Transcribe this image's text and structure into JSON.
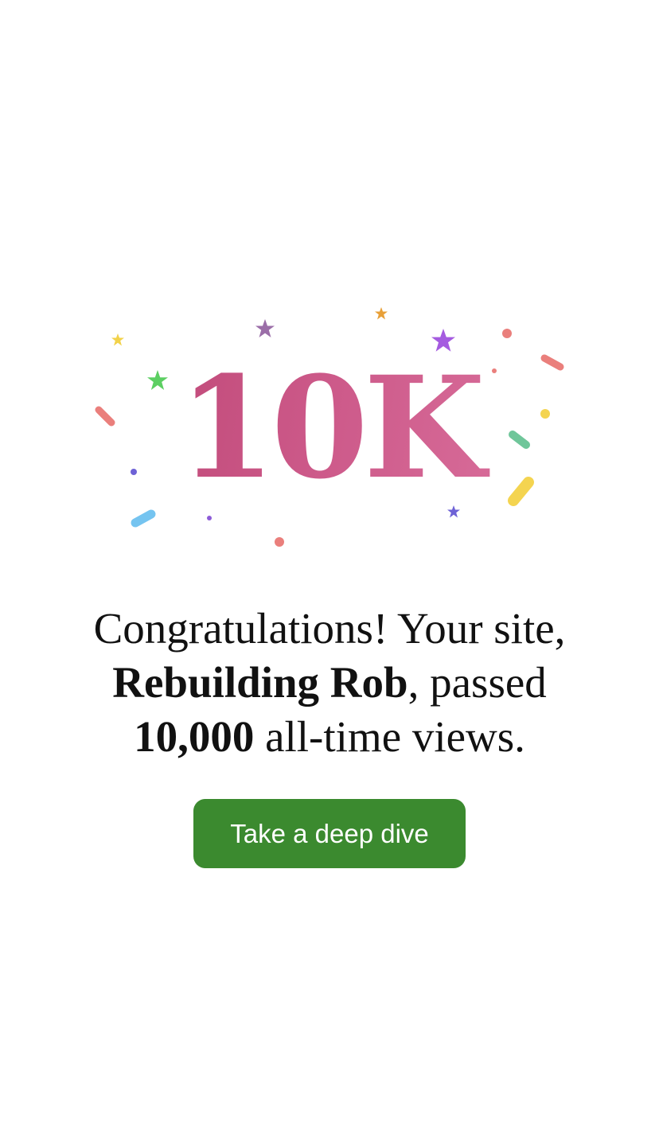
{
  "milestone": {
    "badge": "10K",
    "gradient_start": "#b63d6b",
    "gradient_end": "#e07aa5"
  },
  "message": {
    "intro": "Congratulations! Your site,",
    "site_name": "Rebuilding Rob",
    "after_site": ", passed",
    "views": "10,000",
    "after_views": " all-time views."
  },
  "cta": {
    "label": "Take a deep dive",
    "color": "#3b8a2f"
  },
  "decoration": {
    "name": "confetti",
    "colors": [
      "#f2d24a",
      "#9b6ea8",
      "#e8a038",
      "#a55be0",
      "#ea7f7c",
      "#5ccf62",
      "#75c4f0",
      "#6e62d6",
      "#6fc69a",
      "#f4d450",
      "#8d5bd8"
    ]
  }
}
